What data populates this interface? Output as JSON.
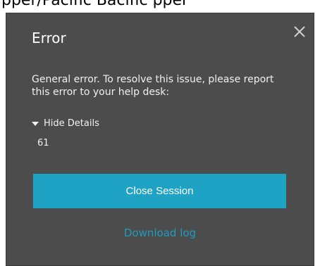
{
  "background_caption": "pper/Pacific  Bacific  pper",
  "dialog": {
    "title": "Error",
    "message": "General error. To resolve this issue, please report this error to your help desk:",
    "details_toggle_label": "Hide Details",
    "details_value": "61",
    "primary_button_label": "Close Session",
    "link_label": "Download log"
  },
  "colors": {
    "dialog_bg": "#4c4c4c",
    "accent": "#1fa3c4",
    "link": "#1d9cbf",
    "text": "#f0f0f0"
  },
  "icons": {
    "close": "close-icon",
    "toggle": "caret-down-icon"
  }
}
